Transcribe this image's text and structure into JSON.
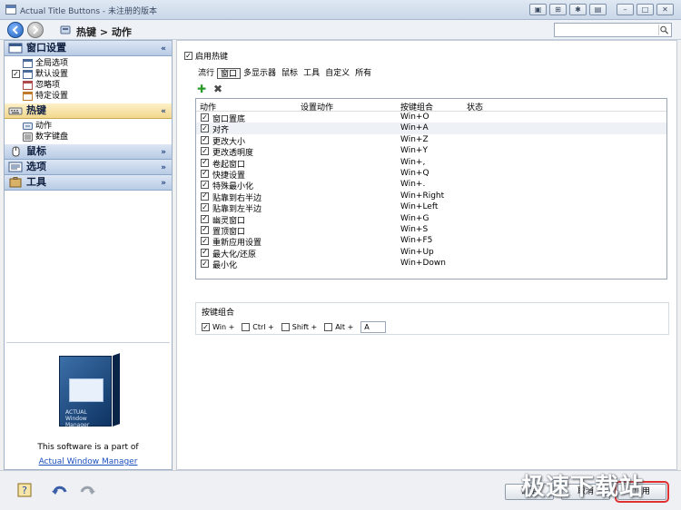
{
  "window": {
    "title": "Actual Title Buttons - 未注册的版本"
  },
  "nav": {
    "breadcrumb": "热键 > 动作"
  },
  "sidebar": {
    "sections": [
      {
        "label": "窗口设置",
        "icon": "window-settings-icon",
        "chevron": "«",
        "items": [
          {
            "label": "全局选项",
            "checked": false
          },
          {
            "label": "默认设置",
            "checked": true
          },
          {
            "label": "忽略项",
            "checked": false
          },
          {
            "label": "特定设置",
            "checked": false
          }
        ]
      },
      {
        "label": "热键",
        "icon": "keyboard-icon",
        "chevron": "«",
        "active": true,
        "items": [
          {
            "label": "动作"
          },
          {
            "label": "数字键盘"
          }
        ]
      },
      {
        "label": "鼠标",
        "icon": "mouse-icon",
        "chevron": "»"
      },
      {
        "label": "选项",
        "icon": "options-icon",
        "chevron": "»"
      },
      {
        "label": "工具",
        "icon": "tools-icon",
        "chevron": "»"
      }
    ]
  },
  "promo": {
    "box_lines": [
      "ACTUAL",
      "Window Manager"
    ],
    "text": "This software is a part of",
    "link": "Actual Window Manager"
  },
  "main": {
    "enable_label": "启用热键",
    "tabs": [
      "流行",
      "窗口",
      "多显示器",
      "鼠标",
      "工具",
      "自定义",
      "所有"
    ],
    "active_tab": 1,
    "columns": [
      "动作",
      "设置动作",
      "按键组合",
      "状态"
    ],
    "rows": [
      {
        "name": "窗口置底",
        "keys": "Win+O"
      },
      {
        "name": "对齐",
        "keys": "Win+A"
      },
      {
        "name": "更改大小",
        "keys": "Win+Z"
      },
      {
        "name": "更改透明度",
        "keys": "Win+Y"
      },
      {
        "name": "卷起窗口",
        "keys": "Win+,"
      },
      {
        "name": "快捷设置",
        "keys": "Win+Q"
      },
      {
        "name": "特殊最小化",
        "keys": "Win+."
      },
      {
        "name": "贴靠到右半边",
        "keys": "Win+Right"
      },
      {
        "name": "贴靠到左半边",
        "keys": "Win+Left"
      },
      {
        "name": "幽灵窗口",
        "keys": "Win+G"
      },
      {
        "name": "置顶窗口",
        "keys": "Win+S"
      },
      {
        "name": "重新应用设置",
        "keys": "Win+F5"
      },
      {
        "name": "最大化/还原",
        "keys": "Win+Up"
      },
      {
        "name": "最小化",
        "keys": "Win+Down"
      }
    ],
    "keyset": {
      "label": "按键组合",
      "options": [
        {
          "label": "Win +",
          "checked": true
        },
        {
          "label": "Ctrl +",
          "checked": false
        },
        {
          "label": "Shift +",
          "checked": false
        },
        {
          "label": "Alt +",
          "checked": false
        }
      ],
      "key": "A"
    }
  },
  "footer": {
    "ok": "确定",
    "cancel": "取消",
    "apply": "应用",
    "watermark": "极速下载站"
  }
}
